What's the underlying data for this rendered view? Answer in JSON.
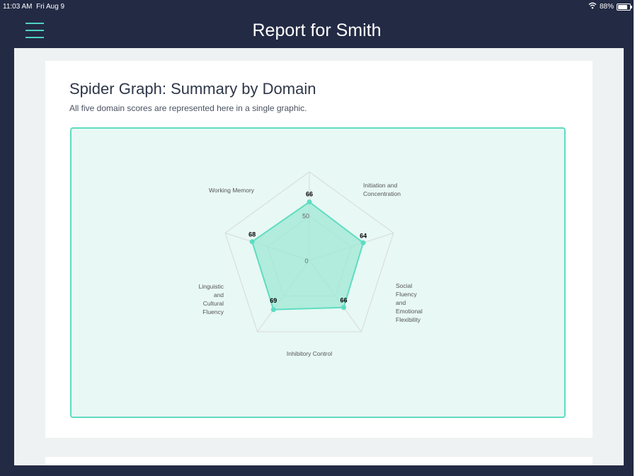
{
  "status_bar": {
    "time": "11:03 AM",
    "date": "Fri Aug 9",
    "battery": "88%"
  },
  "header": {
    "title": "Report for Smith"
  },
  "section": {
    "title": "Spider Graph: Summary by Domain",
    "subtitle": "All five domain scores are represented here in a single graphic."
  },
  "chart_data": {
    "type": "radar",
    "categories": [
      "Working Memory",
      "Initiation and Concentration",
      "Social Fluency and Emotional Flexibility",
      "Inhibitory Control",
      "Linguistic and Cultural Fluency"
    ],
    "category_label_lines": [
      [
        "Working Memory"
      ],
      [
        "Initiation and",
        "Concentration"
      ],
      [
        "Social",
        "Fluency",
        "and",
        "Emotional",
        "Flexibility"
      ],
      [
        "Inhibitory Control"
      ],
      [
        "Linguistic",
        "and",
        "Cultural",
        "Fluency"
      ]
    ],
    "values": [
      66,
      64,
      66,
      69,
      68
    ],
    "radial_ticks": [
      "0",
      "50"
    ],
    "range": [
      0,
      100
    ],
    "fill_color": "#9fe8d6",
    "stroke_color": "#5fdcc1",
    "grid": true
  }
}
